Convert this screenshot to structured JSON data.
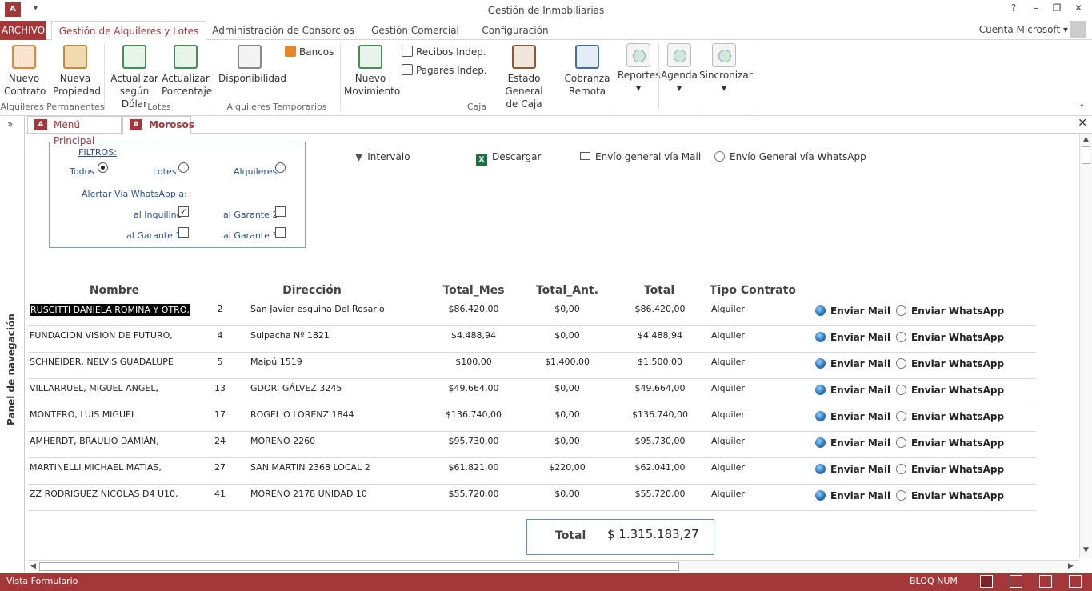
{
  "window": {
    "title": "Gestión de Inmobiliarias",
    "help": "?",
    "account": "Cuenta Microsoft"
  },
  "ribbon_tabs": [
    {
      "label": "ARCHIVO"
    },
    {
      "label": "Gestión de Alquileres y Lotes",
      "active": true
    },
    {
      "label": "Administración de Consorcios"
    },
    {
      "label": "Gestión Comercial"
    },
    {
      "label": "Configuración"
    }
  ],
  "ribbon": {
    "nuevo_contrato": "Nuevo\nContrato",
    "nueva_propiedad": "Nueva\nPropiedad",
    "actualizar_dolar": "Actualizar\nsegún Dólar",
    "actualizar_porcentaje": "Actualizar\nPorcentaje",
    "disponibilidad": "Disponibilidad",
    "bancos": "Bancos",
    "nuevo_movimiento": "Nuevo\nMovimiento",
    "recibos": "Recibos Indep.",
    "pagares": "Pagarés Indep.",
    "estado_caja": "Estado General\nde Caja",
    "cobranza": "Cobranza\nRemota",
    "reportes": "Reportes",
    "agenda": "Agenda",
    "sincronizar": "Sincronizar",
    "groups": {
      "alq_perm": "Alquileres Permanentes",
      "lotes": "Lotes",
      "alq_temp": "Alquileres Temporarios",
      "caja": "Caja"
    }
  },
  "nav": {
    "label": "Panel de navegación",
    "toggle": "»"
  },
  "doc_tabs": [
    {
      "label": "Menú Principal"
    },
    {
      "label": "Morosos",
      "active": true
    }
  ],
  "filters": {
    "title": "FILTROS:",
    "todos": "Todos",
    "lotes": "Lotes",
    "alquileres": "Alquileres",
    "selected": "Todos",
    "alert_title": "Alertar Vía WhatsApp a:",
    "inquilino": "al Inquilino",
    "garante1": "al Garante 1",
    "garante2": "al Garante 2",
    "garante3": "al Garante 3",
    "inquilino_checked": true
  },
  "toolbar": {
    "intervalo": "Intervalo",
    "descargar": "Descargar",
    "mail_general": "Envío general vía Mail",
    "whatsapp_general": "Envío General vía WhatsApp"
  },
  "table": {
    "headers": {
      "nombre": "Nombre",
      "direccion": "Dirección",
      "total_mes": "Total_Mes",
      "total_ant": "Total_Ant.",
      "total": "Total",
      "tipo": "Tipo Contrato"
    },
    "action_mail": "Enviar Mail",
    "action_whatsapp": "Enviar WhatsApp",
    "rows": [
      {
        "nombre": "RUSCITTI DANIELA ROMINA Y OTRO,",
        "num": "2",
        "direccion": "San Javier esquina Del Rosario",
        "total_mes": "$86.420,00",
        "total_ant": "$0,00",
        "total": "$86.420,00",
        "tipo": "Alquiler",
        "selected": true
      },
      {
        "nombre": "FUNDACION VISION DE FUTURO,",
        "num": "4",
        "direccion": "Suipacha Nº 1821",
        "total_mes": "$4.488,94",
        "total_ant": "$0,00",
        "total": "$4.488,94",
        "tipo": "Alquiler"
      },
      {
        "nombre": "SCHNEIDER, NELVIS GUADALUPE",
        "num": "5",
        "direccion": "Maipú 1519",
        "total_mes": "$100,00",
        "total_ant": "$1.400,00",
        "total": "$1.500,00",
        "tipo": "Alquiler"
      },
      {
        "nombre": "VILLARRUEL, MIGUEL ANGEL,",
        "num": "13",
        "direccion": "GDOR. GÁLVEZ 3245",
        "total_mes": "$49.664,00",
        "total_ant": "$0,00",
        "total": "$49.664,00",
        "tipo": "Alquiler"
      },
      {
        "nombre": "MONTERO, LUIS MIGUEL",
        "num": "17",
        "direccion": "ROGELIO LORENZ 1844",
        "total_mes": "$136.740,00",
        "total_ant": "$0,00",
        "total": "$136.740,00",
        "tipo": "Alquiler"
      },
      {
        "nombre": "AMHERDT, BRAULIO DAMIÁN,",
        "num": "24",
        "direccion": "MORENO 2260",
        "total_mes": "$95.730,00",
        "total_ant": "$0,00",
        "total": "$95.730,00",
        "tipo": "Alquiler"
      },
      {
        "nombre": "MARTINELLI MICHAEL MATIAS,",
        "num": "27",
        "direccion": "SAN MARTIN 2368 LOCAL 2",
        "total_mes": "$61.821,00",
        "total_ant": "$220,00",
        "total": "$62.041,00",
        "tipo": "Alquiler"
      },
      {
        "nombre": "ZZ RODRIGUEZ NICOLAS D4 U10,",
        "num": "41",
        "direccion": "MORENO 2178 UNIDAD 10",
        "total_mes": "$55.720,00",
        "total_ant": "$0,00",
        "total": "$55.720,00",
        "tipo": "Alquiler"
      }
    ]
  },
  "summary": {
    "label": "Total",
    "value": "$ 1.315.183,27"
  },
  "statusbar": {
    "left": "Vista Formulario",
    "num": "BLOQ NUM"
  }
}
